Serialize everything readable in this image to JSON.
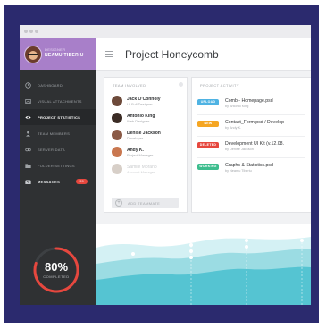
{
  "app": {
    "title": "Project Honeycomb"
  },
  "profile": {
    "role": "DESIGNER",
    "name": "NEAMU TIBERIU"
  },
  "sidebar": {
    "items": [
      {
        "label": "DASHBOARD",
        "icon": "clock-icon",
        "active": false
      },
      {
        "label": "VISUAL ATTACHMENTS",
        "icon": "image-icon",
        "active": false
      },
      {
        "label": "PROJECT STATISTICS",
        "icon": "eye-icon",
        "active": true
      },
      {
        "label": "TEAM MEMBERS",
        "icon": "person-icon",
        "active": false
      },
      {
        "label": "SERVER DATA",
        "icon": "link-icon",
        "active": false
      },
      {
        "label": "FOLDER SETTINGS",
        "icon": "folder-icon",
        "active": false
      },
      {
        "label": "MESSAGES",
        "icon": "envelope-icon",
        "active": false,
        "badge": "99"
      }
    ],
    "progress": {
      "value": 0.8,
      "label": "80%",
      "caption": "COMPLETED"
    }
  },
  "team": {
    "title": "TEAM INVOLVED",
    "members": [
      {
        "name": "Jack O'Connoly",
        "role": "UI Full Designer"
      },
      {
        "name": "Antonio King",
        "role": "Web Designer"
      },
      {
        "name": "Denise Jackson",
        "role": "Developer"
      },
      {
        "name": "Andy K.",
        "role": "Project Manager"
      },
      {
        "name": "Samile Morano",
        "role": "Account Manager"
      }
    ],
    "add_label": "ADD TEAMMATE"
  },
  "activity": {
    "title": "PROJECT ACTIVITY",
    "items": [
      {
        "tag": "UPLOAD",
        "text": "Comb - Homepage.psd",
        "by": "by Antonio King"
      },
      {
        "tag": "NEW",
        "text": "Contact_Form.psd / Develop",
        "by": "by Andy K."
      },
      {
        "tag": "DELETED",
        "text": "Development UI Kit (v.12.08.",
        "by": "by Denise Jackson"
      },
      {
        "tag": "WORKING",
        "text": "Graphs & Statistics.psd",
        "by": "by Neamu Tiberiu"
      }
    ]
  },
  "colors": {
    "frame": "#2b2a6e",
    "sidebar": "#2f3133",
    "profile": "#a87fc9",
    "progress": "#e6473e",
    "tag_upload": "#4fb3e3",
    "tag_new": "#f5a623",
    "tag_deleted": "#e6473e",
    "tag_working": "#3dbd8e",
    "wave_1": "#cfeff2",
    "wave_2": "#8fd9e0",
    "wave_3": "#4fc3d1"
  }
}
